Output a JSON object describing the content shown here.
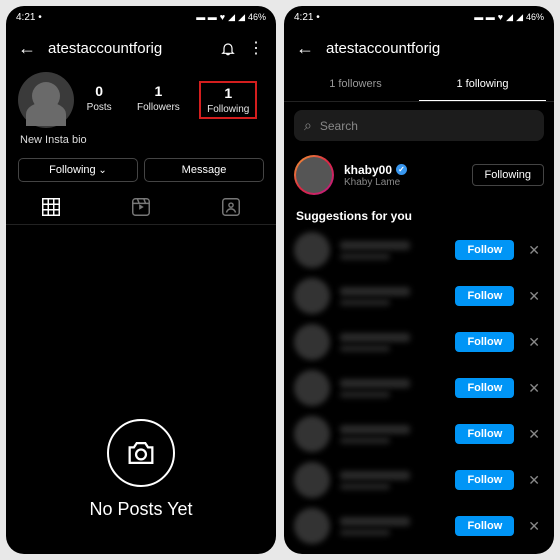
{
  "status": {
    "time": "4:21",
    "dot": "•",
    "battery": "46%"
  },
  "left": {
    "username": "atestaccountforig",
    "stats": [
      {
        "num": "0",
        "label": "Posts"
      },
      {
        "num": "1",
        "label": "Followers"
      },
      {
        "num": "1",
        "label": "Following"
      }
    ],
    "bio": "New Insta bio",
    "btn_following": "Following",
    "btn_message": "Message",
    "empty_title": "No Posts Yet"
  },
  "right": {
    "username": "atestaccountforig",
    "tab_followers": "1 followers",
    "tab_following": "1 following",
    "search_placeholder": "Search",
    "user": {
      "name": "khaby00",
      "sub": "Khaby Lame"
    },
    "btn_following": "Following",
    "suggestions_title": "Suggestions for you",
    "btn_follow": "Follow",
    "suggestion_count": 7
  }
}
